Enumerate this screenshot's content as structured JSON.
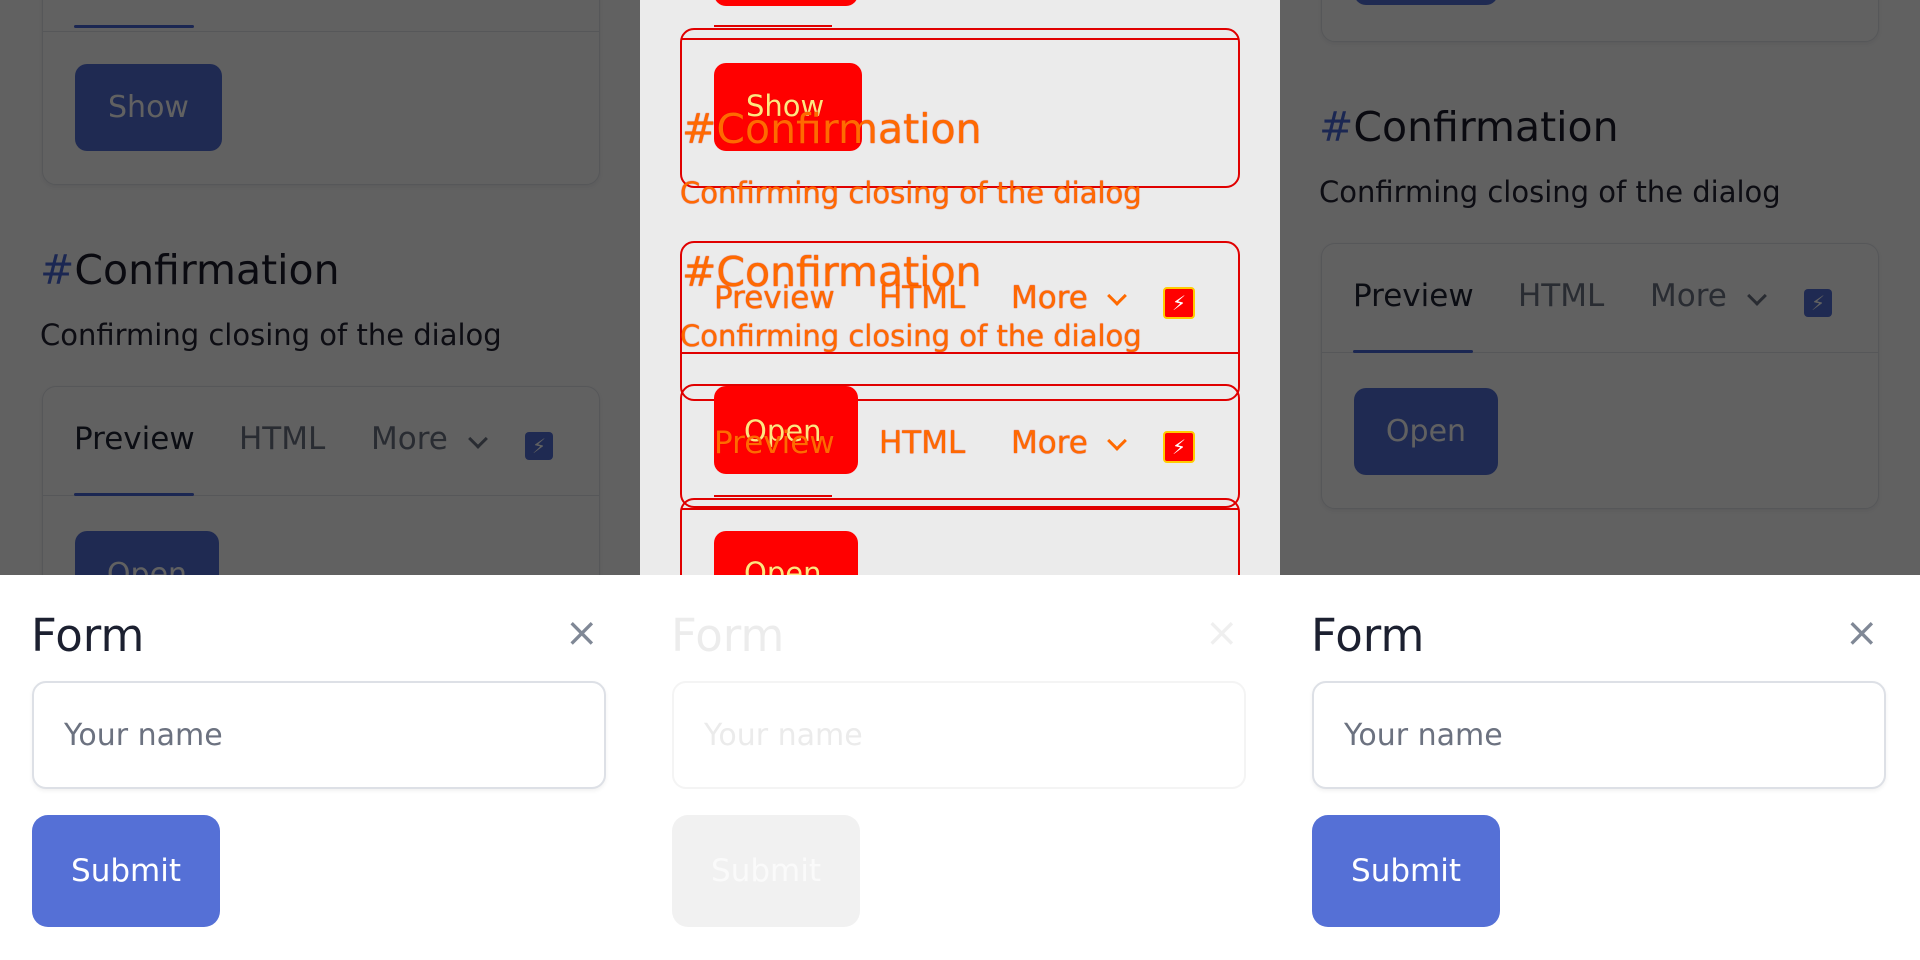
{
  "docs": {
    "show_label": "Show",
    "open_label": "Open",
    "section_hash": "#",
    "section_title": "Confirmation",
    "section_desc": "Confirming closing of the dialog",
    "tabs": [
      "Preview",
      "HTML",
      "More"
    ],
    "bolt_icon": "lightning-icon"
  },
  "form": {
    "title": "Form",
    "close_icon": "×",
    "name_placeholder": "Your name",
    "submit_label": "Submit"
  },
  "colors": {
    "accent": "#5570d6",
    "overlay": "#000000",
    "debug_outline": "#e00000",
    "debug_text": "#ff6a00"
  }
}
